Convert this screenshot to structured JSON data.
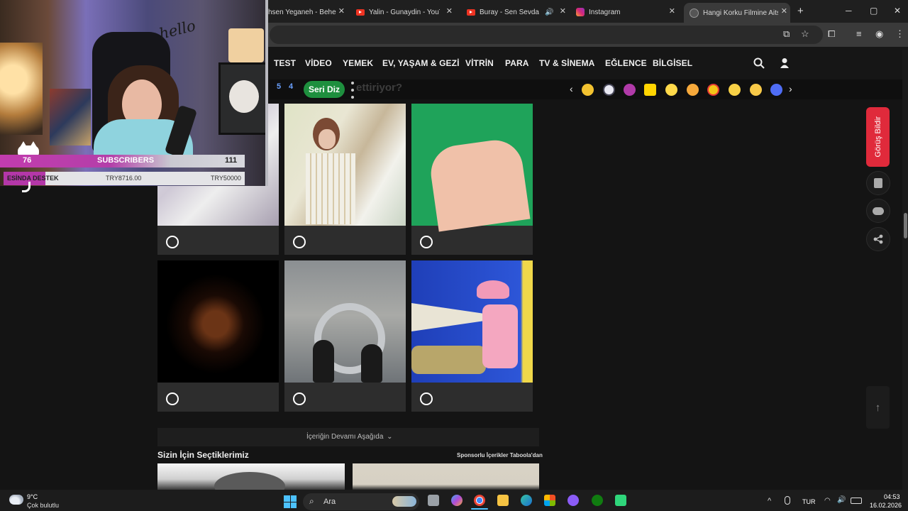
{
  "browser": {
    "tabs": [
      {
        "title": "hsen Yeganeh - Behe"
      },
      {
        "title": "Yalin - Gunaydin - YouTub"
      },
      {
        "title": "Buray - Sen Sevda Ma"
      },
      {
        "title": "Instagram"
      },
      {
        "title": "Hangi Korku Filmine Aitsi"
      }
    ],
    "new_tab": "+",
    "window_controls": {
      "minimize": "─",
      "maximize": "▢",
      "close": "✕"
    }
  },
  "nav": {
    "items": [
      "TEST",
      "VİDEO",
      "YEMEK",
      "EV, YAŞAM & GEZİ",
      "VİTRİN",
      "PARA",
      "TV & SİNEMA",
      "EĞLENCE",
      "BİLGİSEL"
    ]
  },
  "series": {
    "numbers": [
      "5",
      "4"
    ],
    "button": "Seri Diz",
    "faded_text": "ettiriyor?"
  },
  "stream": {
    "hello": "hello",
    "subs_left": "76",
    "subs_label": "SUBSCRIBERS",
    "subs_right": "111",
    "bar_label": "ESİNDA DESTEK",
    "bar_current": "TRY8716.00",
    "bar_goal": "TRY50000",
    "goal_progress": 0.174
  },
  "content": {
    "more_below": "İçeriğin Devamı Aşağıda",
    "picks_title": "Sizin İçin Seçtiklerimiz",
    "sponsored": "Sponsorlu İçerikler Taboola'dan"
  },
  "sidebar": {
    "feedback": "Görüş Bildir"
  },
  "taskbar": {
    "temp": "9°C",
    "weather": "Çok bulutlu",
    "search": "Ara",
    "lang": "TUR",
    "time": "04:53",
    "date": "16.02.2026"
  }
}
